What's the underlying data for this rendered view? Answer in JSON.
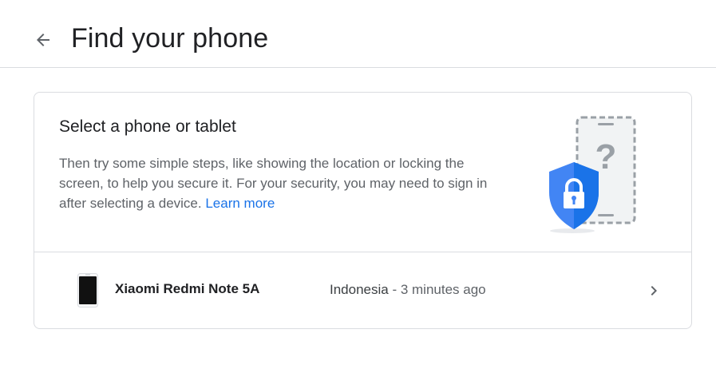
{
  "header": {
    "title": "Find your phone"
  },
  "card": {
    "title": "Select a phone or tablet",
    "description": "Then try some simple steps, like showing the location or locking the screen, to help you secure it. For your security, you may need to sign in after selecting a device.",
    "learn_more_label": "Learn more"
  },
  "devices": [
    {
      "name": "Xiaomi Redmi Note 5A",
      "location": "Indonesia",
      "separator": " - ",
      "last_seen": "3 minutes ago"
    }
  ],
  "icons": {
    "back": "arrow-back-icon",
    "chevron": "chevron-right-icon",
    "illustration": "phone-shield-lock-icon"
  },
  "colors": {
    "accent": "#1a73e8",
    "shield": "#4285f4",
    "divider": "#dadce0"
  }
}
